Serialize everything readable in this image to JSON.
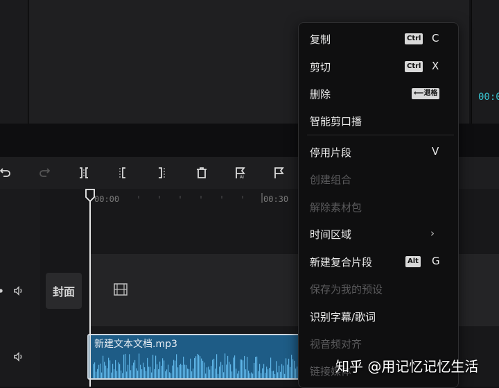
{
  "preview": {
    "timecode": "00:0"
  },
  "ruler": {
    "ticks": [
      "00:00",
      "00:30"
    ]
  },
  "timeline": {
    "cover_label": "封面",
    "audio_clip_name": "新建文本文档.mp3"
  },
  "context_menu": {
    "items": [
      {
        "label": "复制",
        "modifier": "Ctrl",
        "key": "C",
        "enabled": true
      },
      {
        "label": "剪切",
        "modifier": "Ctrl",
        "key": "X",
        "enabled": true
      },
      {
        "label": "删除",
        "modifier": "⟵退格",
        "key": "",
        "enabled": true
      },
      {
        "label": "智能剪口播",
        "modifier": "",
        "key": "",
        "enabled": true
      },
      {
        "label": "停用片段",
        "modifier": "",
        "key": "V",
        "enabled": true
      },
      {
        "label": "创建组合",
        "modifier": "",
        "key": "",
        "enabled": false
      },
      {
        "label": "解除素材包",
        "modifier": "",
        "key": "",
        "enabled": false
      },
      {
        "label": "时间区域",
        "modifier": "",
        "key": "",
        "enabled": true,
        "submenu": true
      },
      {
        "label": "新建复合片段",
        "modifier": "Alt",
        "key": "G",
        "enabled": true
      },
      {
        "label": "保存为我的预设",
        "modifier": "",
        "key": "",
        "enabled": false
      },
      {
        "label": "识别字幕/歌词",
        "modifier": "",
        "key": "",
        "enabled": true
      },
      {
        "label": "视音频对齐",
        "modifier": "",
        "key": "",
        "enabled": false
      },
      {
        "label": "链接媒体",
        "modifier": "",
        "key": "",
        "enabled": false
      }
    ],
    "submenu_glyph": "›"
  },
  "watermark": "知乎 @用记忆记忆生活",
  "colors": {
    "accent_cyan": "#39c6d3",
    "audio_clip": "#1e5c86",
    "menu_bg": "#0f0f10"
  }
}
